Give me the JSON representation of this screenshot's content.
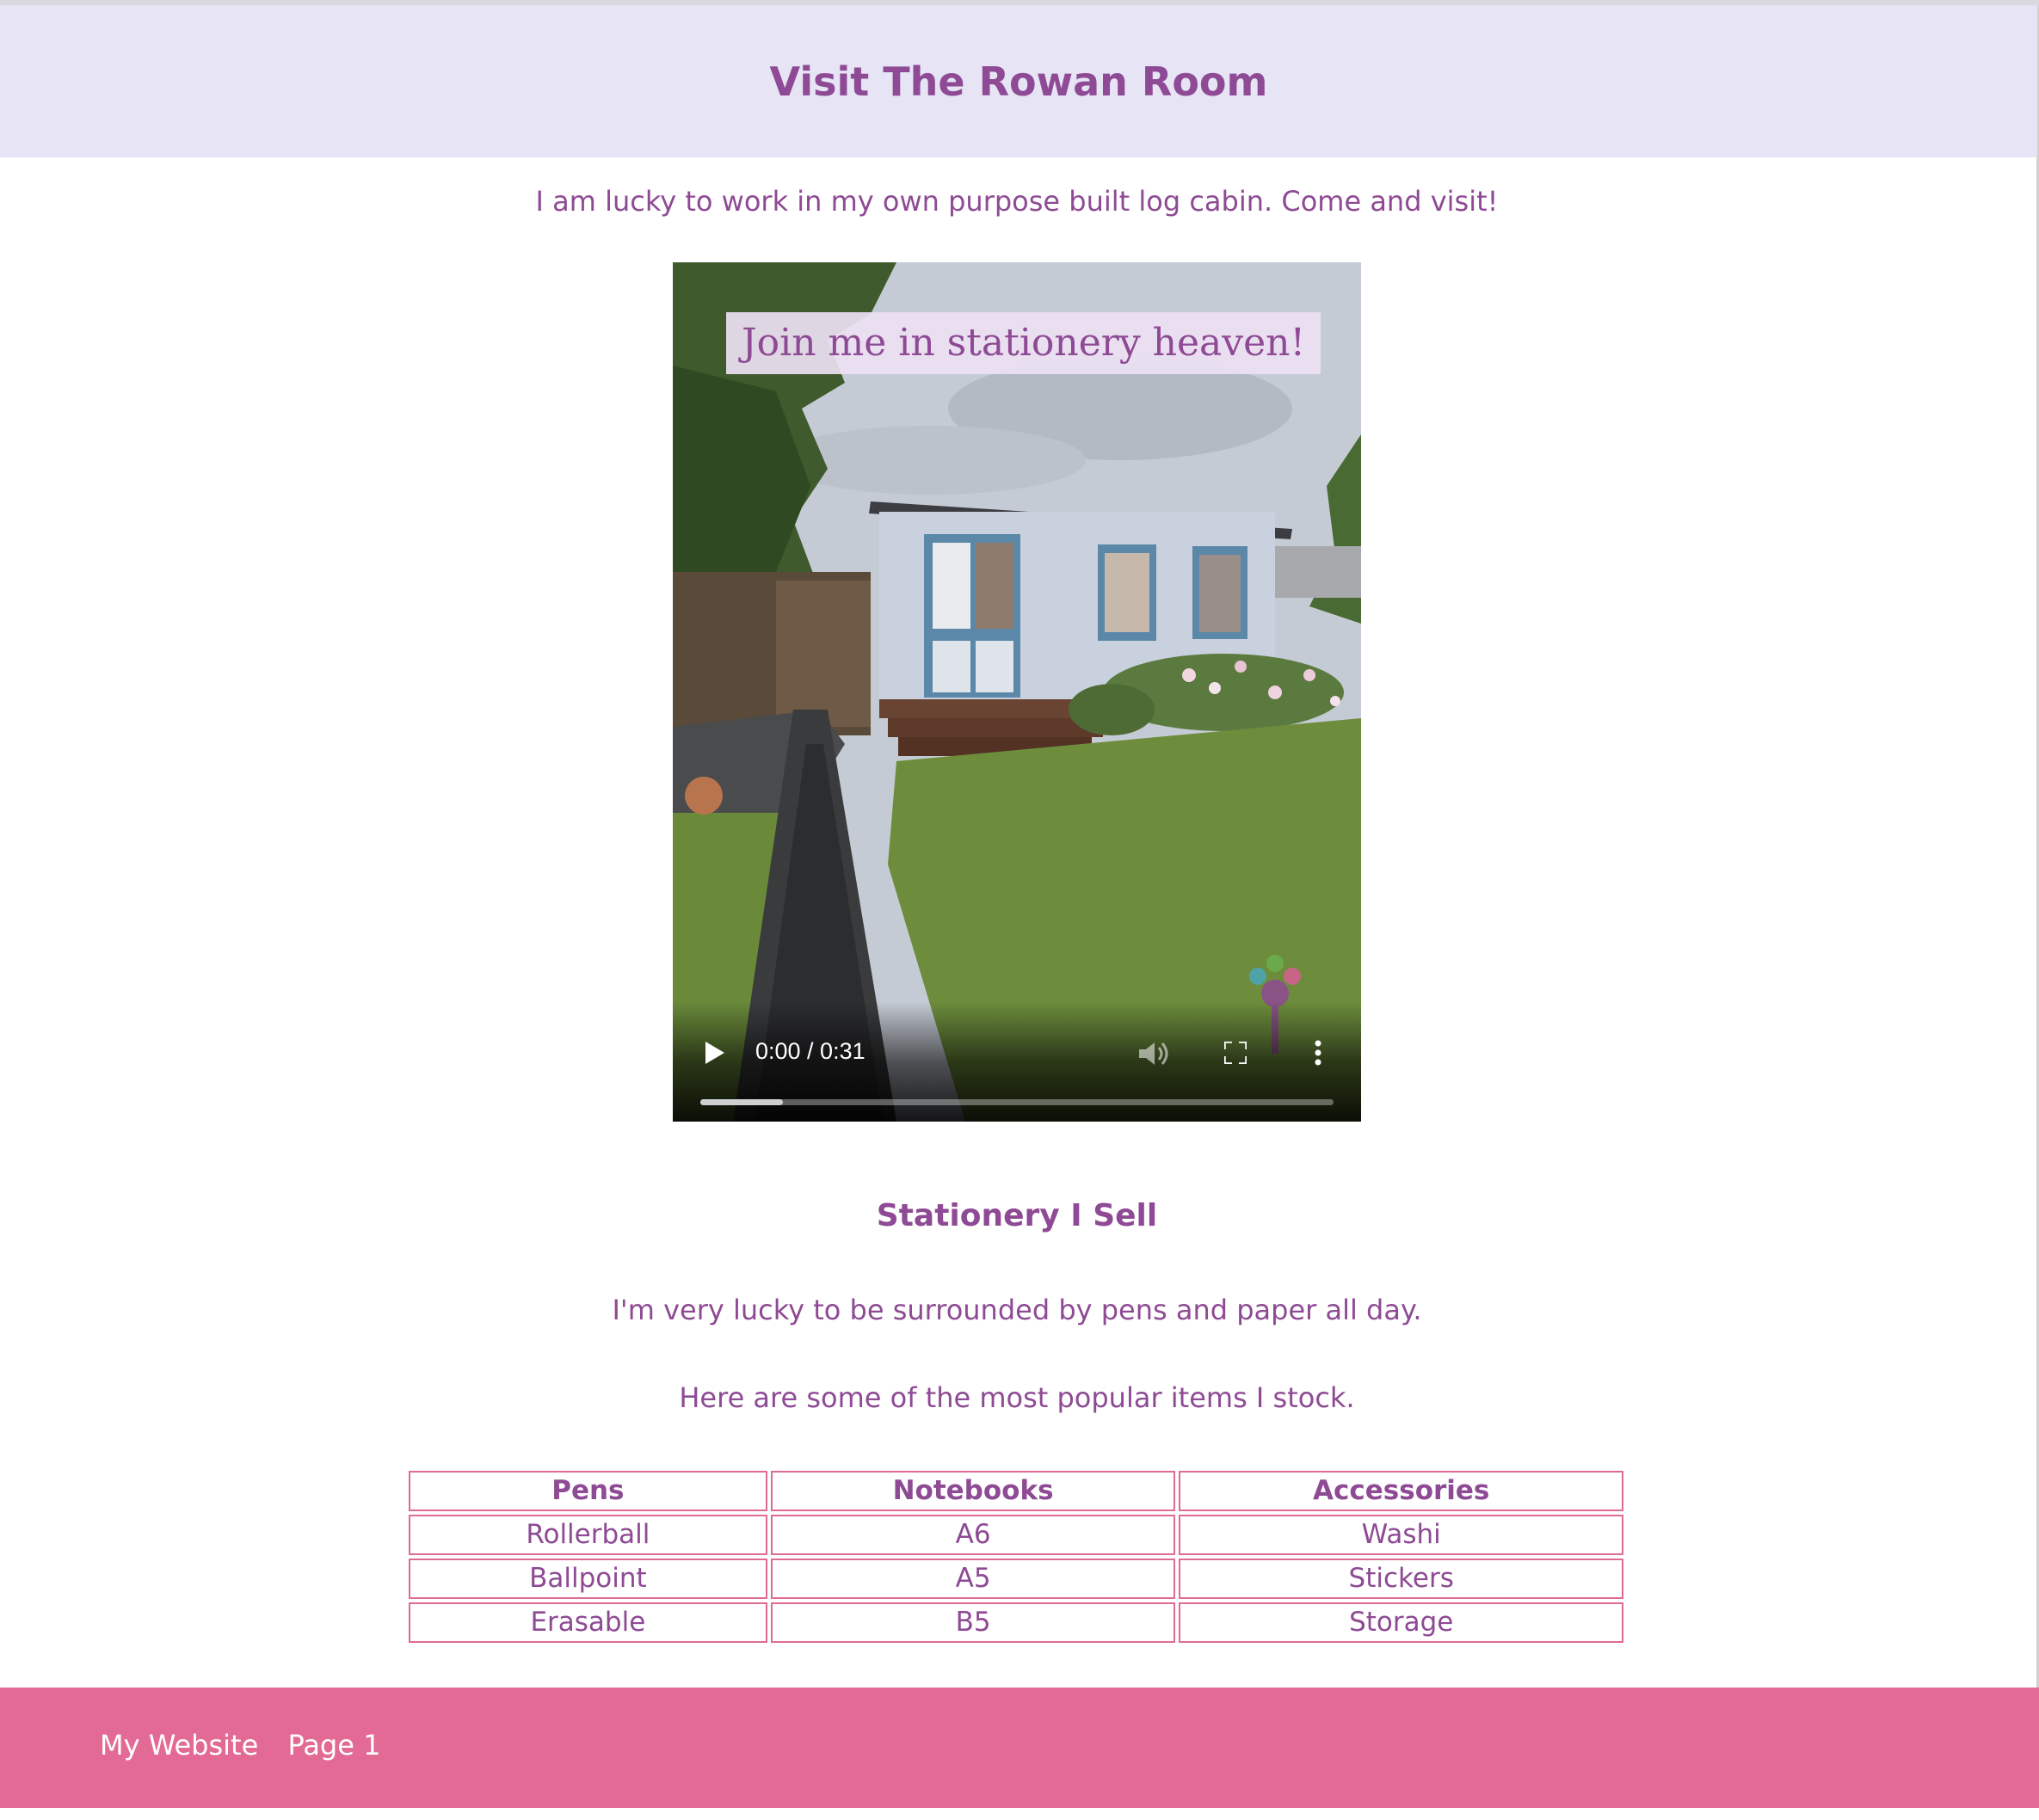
{
  "header": {
    "title": "Visit The Rowan Room"
  },
  "intro": {
    "text": "I am lucky to work in my own purpose built log cabin. Come and visit!"
  },
  "video": {
    "overlay_text": "Join me in stationery heaven!",
    "time": "0:00 / 0:31",
    "progress_fraction": 0.13,
    "icons": [
      "play-icon",
      "volume-icon",
      "fullscreen-icon",
      "more-icon"
    ]
  },
  "stationery": {
    "title": "Stationery I Sell",
    "para1": "I'm very lucky to be surrounded by pens and paper all day.",
    "para2": "Here are some of the most popular items I stock.",
    "table": {
      "headers": [
        "Pens",
        "Notebooks",
        "Accessories"
      ],
      "rows": [
        [
          "Rollerball",
          "A6",
          "Washi"
        ],
        [
          "Ballpoint",
          "A5",
          "Stickers"
        ],
        [
          "Erasable",
          "B5",
          "Storage"
        ]
      ]
    }
  },
  "footer": {
    "site_name": "My Website",
    "page_label": "Page 1"
  },
  "colors": {
    "accent": "#8e4a94",
    "header_bg": "#e6e4f5",
    "footer_bg": "#e36a94",
    "table_border": "#df6b95"
  }
}
